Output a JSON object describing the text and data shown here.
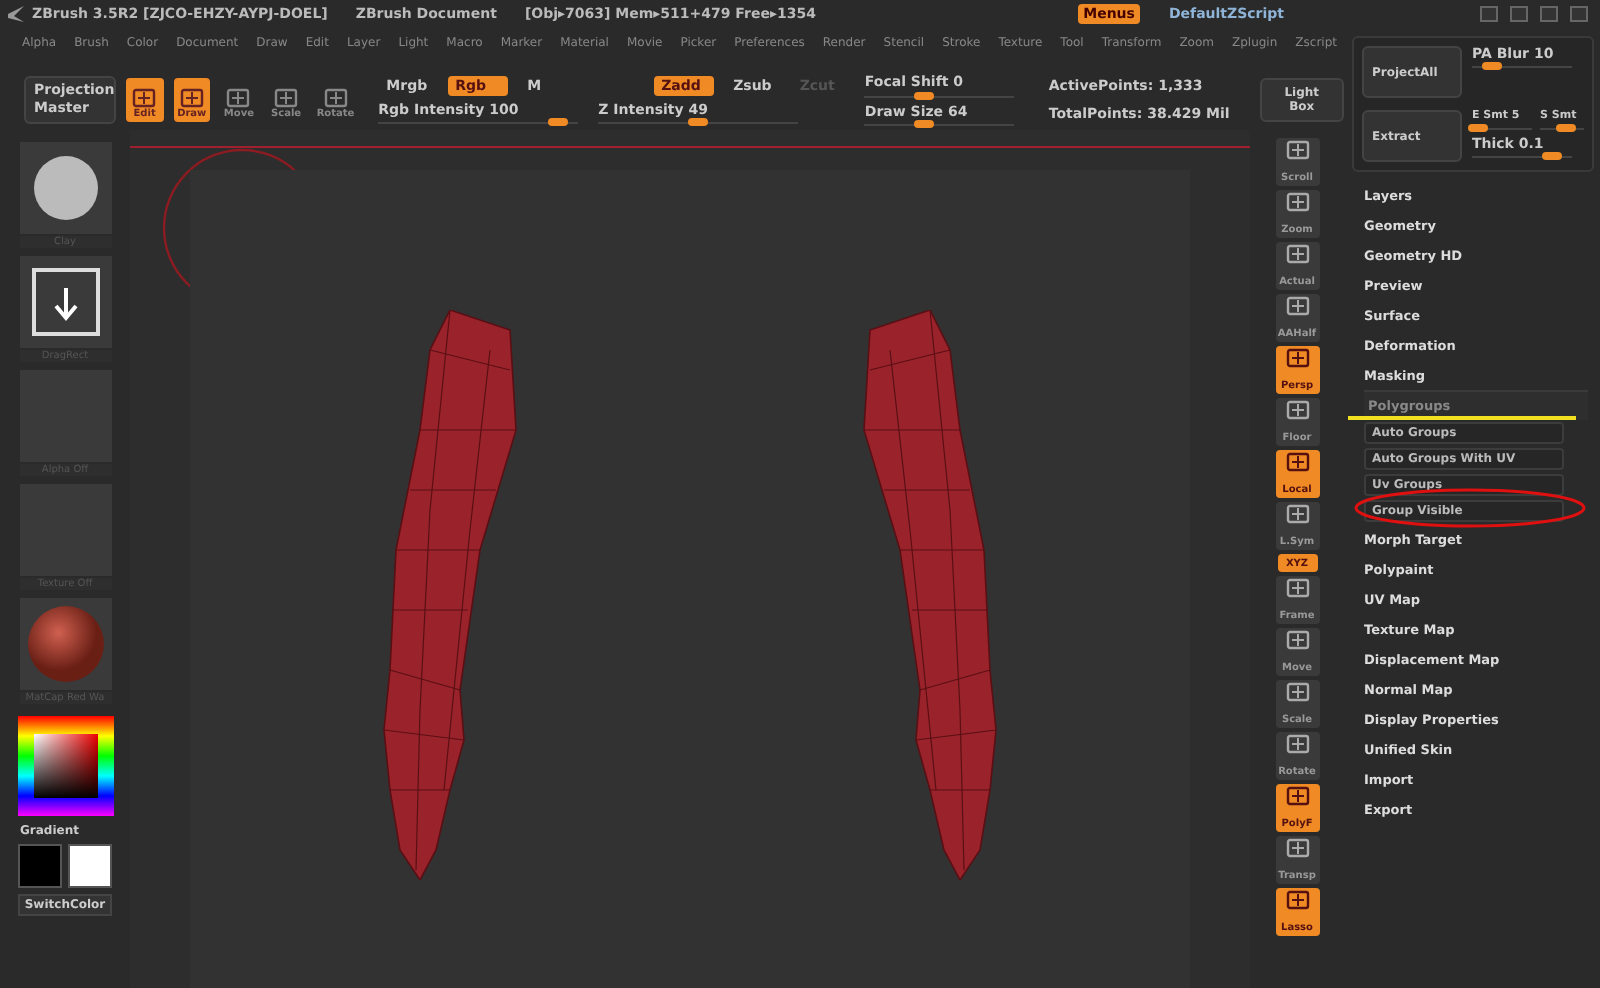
{
  "title_bar": {
    "app": "ZBrush 3.5R2",
    "serial": "[ZJCO-EHZY-AYPJ-DOEL]",
    "document": "ZBrush Document",
    "stats": "[Obj▸7063] Mem▸511+479 Free▸1354"
  },
  "menus_button": {
    "label": "Menus",
    "selected": true
  },
  "script": "DefaultZScript",
  "menu_bar": [
    "Alpha",
    "Brush",
    "Color",
    "Document",
    "Draw",
    "Edit",
    "Layer",
    "Light",
    "Macro",
    "Marker",
    "Material",
    "Movie",
    "Picker",
    "Preferences",
    "Render",
    "Stencil",
    "Stroke",
    "Texture",
    "Tool",
    "Transform",
    "Zoom",
    "Zplugin",
    "Zscript"
  ],
  "shelf": {
    "projection_master": "Projection Master",
    "modes": [
      {
        "label": "Edit",
        "selected": true
      },
      {
        "label": "Draw",
        "selected": true
      },
      {
        "label": "Move",
        "selected": false
      },
      {
        "label": "Scale",
        "selected": false
      },
      {
        "label": "Rotate",
        "selected": false
      }
    ],
    "color_modes": [
      {
        "label": "Mrgb",
        "selected": false
      },
      {
        "label": "Rgb",
        "selected": true
      },
      {
        "label": "M",
        "selected": false
      }
    ],
    "depth_modes": [
      {
        "label": "Zadd",
        "selected": true,
        "disabled": false
      },
      {
        "label": "Zsub",
        "selected": false,
        "disabled": false
      },
      {
        "label": "Zcut",
        "selected": false,
        "disabled": true
      }
    ],
    "intensity_sliders": [
      {
        "label": "Rgb Intensity",
        "value": "100",
        "level": 0.9
      },
      {
        "label": "Z Intensity",
        "value": "49",
        "level": 0.5
      }
    ],
    "brush_sliders": [
      {
        "label": "Focal Shift",
        "value": "0",
        "level": 0.4
      },
      {
        "label": "Draw Size",
        "value": "64",
        "level": 0.4
      }
    ],
    "points": [
      "ActivePoints: 1,333",
      "TotalPoints: 38.429 Mil"
    ],
    "light_box": "Light Box"
  },
  "left_shelf": [
    {
      "label": "Clay",
      "kind": "sphere"
    },
    {
      "label": "DragRect",
      "kind": "stroke"
    },
    {
      "label": "Alpha Off",
      "kind": "empty"
    },
    {
      "label": "Texture Off",
      "kind": "empty"
    },
    {
      "label": "MatCap Red Wa",
      "kind": "material"
    }
  ],
  "color_picker": {
    "gradient": "Gradient",
    "switch": "SwitchColor"
  },
  "right_toolbar": [
    {
      "label": "Scroll",
      "kind": "button",
      "selected": false
    },
    {
      "label": "Zoom",
      "kind": "button",
      "selected": false
    },
    {
      "label": "Actual",
      "kind": "button",
      "selected": false
    },
    {
      "label": "AAHalf",
      "kind": "button",
      "selected": false
    },
    {
      "label": "Persp",
      "kind": "button",
      "selected": true
    },
    {
      "label": "Floor",
      "kind": "button",
      "selected": false
    },
    {
      "label": "Local",
      "kind": "button",
      "selected": true
    },
    {
      "label": "L.Sym",
      "kind": "button",
      "selected": false
    },
    {
      "label": "XYZ",
      "kind": "small",
      "selected": true
    },
    {
      "label": "Frame",
      "kind": "button",
      "selected": false
    },
    {
      "label": "Move",
      "kind": "button",
      "selected": false
    },
    {
      "label": "Scale",
      "kind": "button",
      "selected": false
    },
    {
      "label": "Rotate",
      "kind": "button",
      "selected": false
    },
    {
      "label": "PolyF",
      "kind": "button",
      "selected": true
    },
    {
      "label": "Transp",
      "kind": "button",
      "selected": false
    },
    {
      "label": "Lasso",
      "kind": "button",
      "selected": true
    }
  ],
  "subpalette": {
    "project_all": "ProjectAll",
    "pa_blur": {
      "label": "PA Blur",
      "value": "10",
      "level": 0.2
    },
    "extract": "Extract",
    "e_smt": {
      "label": "E Smt",
      "value": "5",
      "level": 0.1
    },
    "s_smt": {
      "label": "S Smt",
      "level": 0.6
    },
    "thick": {
      "label": "Thick",
      "value": "0.1",
      "level": 0.8
    }
  },
  "tool_menu": [
    {
      "label": "Layers",
      "expanded": false
    },
    {
      "label": "Geometry",
      "expanded": false
    },
    {
      "label": "Geometry HD",
      "expanded": false
    },
    {
      "label": "Preview",
      "expanded": false
    },
    {
      "label": "Surface",
      "expanded": false
    },
    {
      "label": "Deformation",
      "expanded": false
    },
    {
      "label": "Masking",
      "expanded": false
    },
    {
      "label": "Polygroups",
      "expanded": true,
      "children": [
        "Auto Groups",
        "Auto Groups With UV",
        "Uv Groups",
        "Group Visible"
      ]
    },
    {
      "label": "Morph Target",
      "expanded": false
    },
    {
      "label": "Polypaint",
      "expanded": false
    },
    {
      "label": "UV Map",
      "expanded": false
    },
    {
      "label": "Texture Map",
      "expanded": false
    },
    {
      "label": "Displacement Map",
      "expanded": false
    },
    {
      "label": "Normal Map",
      "expanded": false
    },
    {
      "label": "Display Properties",
      "expanded": false
    },
    {
      "label": "Unified Skin",
      "expanded": false
    },
    {
      "label": "Import",
      "expanded": false
    },
    {
      "label": "Export",
      "expanded": false
    }
  ]
}
